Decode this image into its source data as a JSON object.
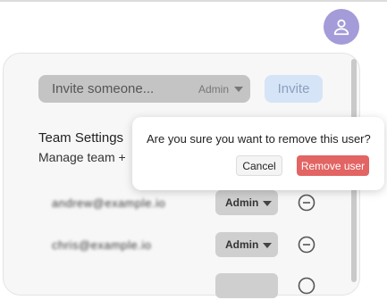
{
  "header": {
    "avatar_icon": "user-icon",
    "avatar_color": "#a49bd9"
  },
  "invite": {
    "placeholder": "Invite someone...",
    "role_value": "Admin",
    "button_label": "Invite"
  },
  "team": {
    "title": "Team Settings",
    "subtitle": "Manage team +"
  },
  "members": [
    {
      "email": "andrew@example.io",
      "role": "Admin",
      "remove_icon": "minus-circle-icon"
    },
    {
      "email": "chris@example.io",
      "role": "Admin",
      "remove_icon": "minus-circle-icon"
    },
    {
      "email": "",
      "role": "",
      "remove_icon": "minus-circle-icon"
    }
  ],
  "confirm": {
    "question": "Are you sure you want to remove this user?",
    "cancel_label": "Cancel",
    "remove_label": "Remove user",
    "remove_color": "#e26463"
  }
}
